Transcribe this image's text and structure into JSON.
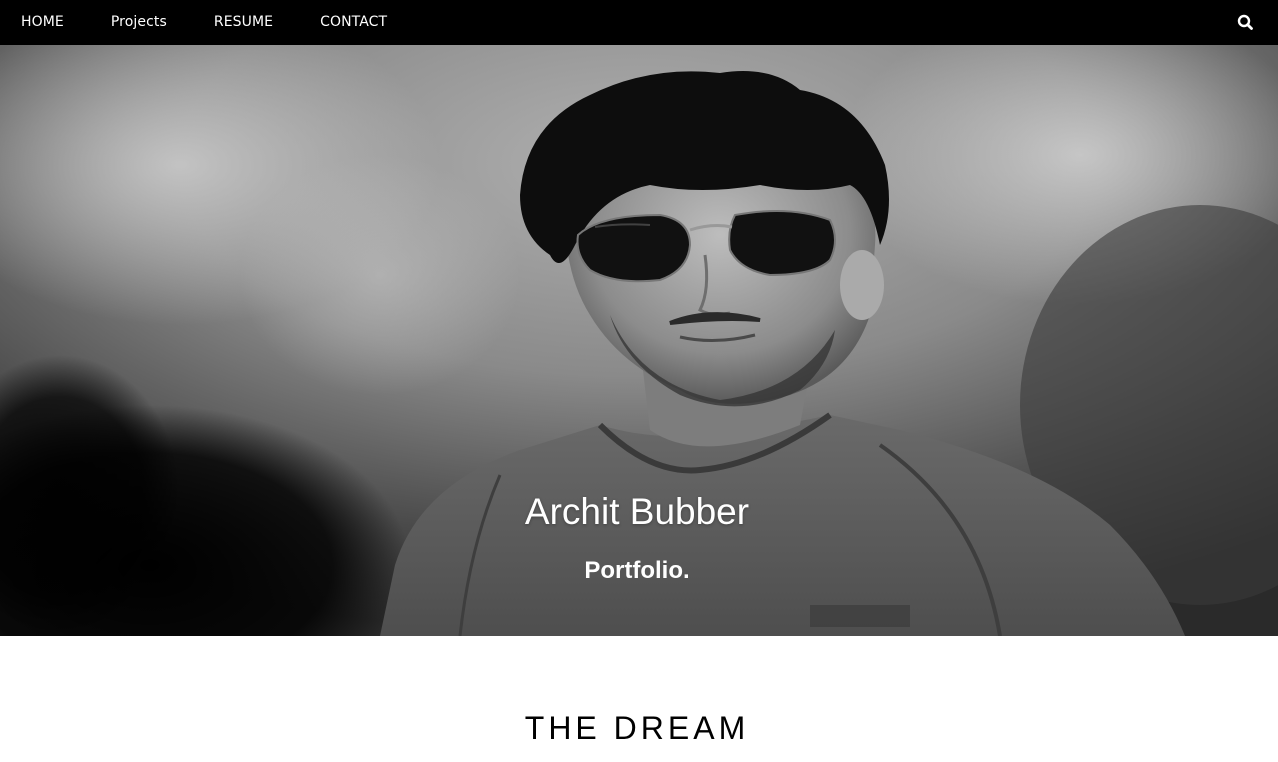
{
  "nav": {
    "items": [
      {
        "label": "HOME"
      },
      {
        "label": "Projects"
      },
      {
        "label": "RESUME"
      },
      {
        "label": "CONTACT"
      }
    ],
    "search_icon": "search-icon"
  },
  "hero": {
    "name": "Archit Bubber",
    "subtitle": "Portfolio."
  },
  "sections": {
    "dream_title": "THE DREAM"
  },
  "colors": {
    "navbar_bg": "#000000",
    "nav_text": "#ffffff",
    "hero_text": "#ffffff",
    "page_bg": "#ffffff"
  }
}
